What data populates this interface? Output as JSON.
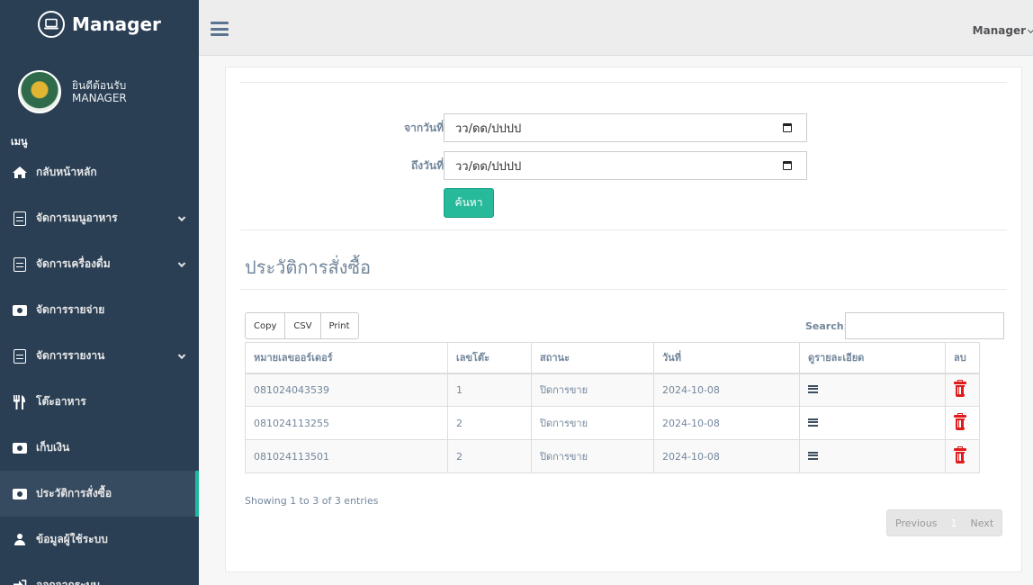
{
  "brand": {
    "title": "Manager",
    "icon": "laptop-icon"
  },
  "profile": {
    "welcome": "ยินดีต้อนรับ",
    "role": "MANAGER"
  },
  "sidebar": {
    "menu_title": "เมนู",
    "items": [
      {
        "label": "กลับหน้าหลัก",
        "icon": "home-icon"
      },
      {
        "label": "จัดการเมนูอาหาร",
        "icon": "document-icon",
        "expandable": true
      },
      {
        "label": "จัดการเครื่องดื่ม",
        "icon": "document-icon",
        "expandable": true
      },
      {
        "label": "จัดการรายจ่าย",
        "icon": "money-icon"
      },
      {
        "label": "จัดการรายงาน",
        "icon": "document-icon",
        "expandable": true
      },
      {
        "label": "โต๊ะอาหาร",
        "icon": "cutlery-icon"
      },
      {
        "label": "เก็บเงิน",
        "icon": "money-icon"
      },
      {
        "label": "ประวัติการสั่งซื้อ",
        "icon": "money-icon",
        "active": true
      },
      {
        "label": "ข้อมูลผู้ใช้ระบบ",
        "icon": "user-icon"
      },
      {
        "label": "ออกจากระบบ",
        "icon": "sign-out-icon"
      }
    ]
  },
  "topbar": {
    "user": "Manager"
  },
  "filter": {
    "from_label": "จากวันที่",
    "to_label": "ถึงวันที่",
    "from_value": "วว/ดด/ปปปป",
    "to_value": "วว/ดด/ปปปป",
    "search_button": "ค้นหา"
  },
  "page_title": "ประวัติการสั่งซื้อ",
  "table_tools": {
    "buttons": [
      "Copy",
      "CSV",
      "Print"
    ],
    "search_label": "Search:"
  },
  "table": {
    "headers": [
      "หมายเลขออร์เดอร์",
      "เลขโต๊ะ",
      "สถานะ",
      "วันที่",
      "ดูรายละเอียด",
      "ลบ"
    ],
    "rows": [
      {
        "order": "081024043539",
        "table_no": "1",
        "status": "ปิดการขาย",
        "date": "2024-10-08"
      },
      {
        "order": "081024113255",
        "table_no": "2",
        "status": "ปิดการขาย",
        "date": "2024-10-08"
      },
      {
        "order": "081024113501",
        "table_no": "2",
        "status": "ปิดการขาย",
        "date": "2024-10-08"
      }
    ]
  },
  "info": "Showing 1 to 3 of 3 entries",
  "pagination": {
    "previous": "Previous",
    "current": "1",
    "next": "Next"
  },
  "colors": {
    "sidebar": "#2a3f54",
    "accent": "#1abb9c",
    "button": "#26b99a",
    "delete": "#e01b1b",
    "text": "#73879c"
  }
}
